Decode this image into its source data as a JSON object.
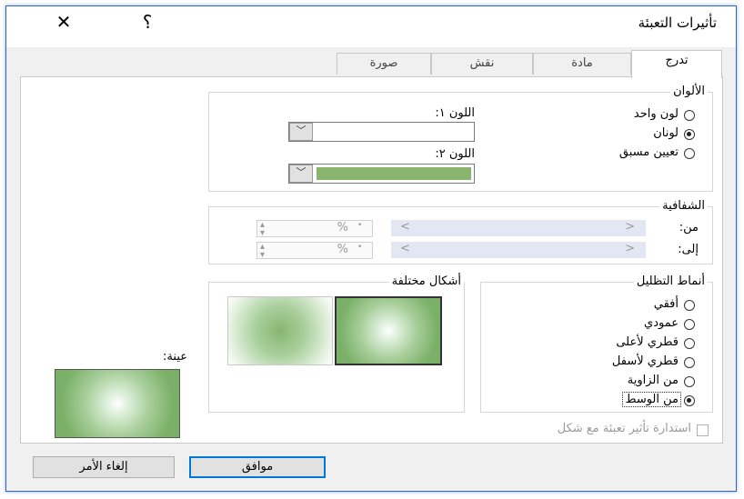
{
  "window": {
    "title": "تأثيرات التعبئة",
    "help": "؟",
    "close": "✕"
  },
  "tabs": [
    {
      "label": "تدرج",
      "active": true
    },
    {
      "label": "مادة",
      "active": false
    },
    {
      "label": "نقش",
      "active": false
    },
    {
      "label": "صورة",
      "active": false
    }
  ],
  "colors": {
    "group_label": "الألوان",
    "options": [
      "لون واحد",
      "لونان",
      "تعيين مسبق"
    ],
    "selected_option": "لونان",
    "color1_label": "اللون ١:",
    "color2_label": "اللون ٢:",
    "color1_value": "#ffffff",
    "color2_value": "#8ab56f"
  },
  "transparency": {
    "group_label": "الشفافية",
    "from_label": "من:",
    "to_label": "إلى:",
    "from_value": "%",
    "to_value": "%"
  },
  "shading": {
    "group_label": "أنماط التظليل",
    "options": [
      "أفقي",
      "عمودي",
      "قطري لأعلى",
      "قطري لأسفل",
      "من الزاوية",
      "من الوسط"
    ],
    "selected_option": "من الوسط"
  },
  "variants": {
    "group_label": "أشكال مختلفة"
  },
  "sample": {
    "label": "عينة:"
  },
  "rotate_checkbox": {
    "label": "استدارة تأثير تعبئة مع شكل",
    "checked": false
  },
  "buttons": {
    "ok": "موافق",
    "cancel": "إلغاء الأمر"
  }
}
